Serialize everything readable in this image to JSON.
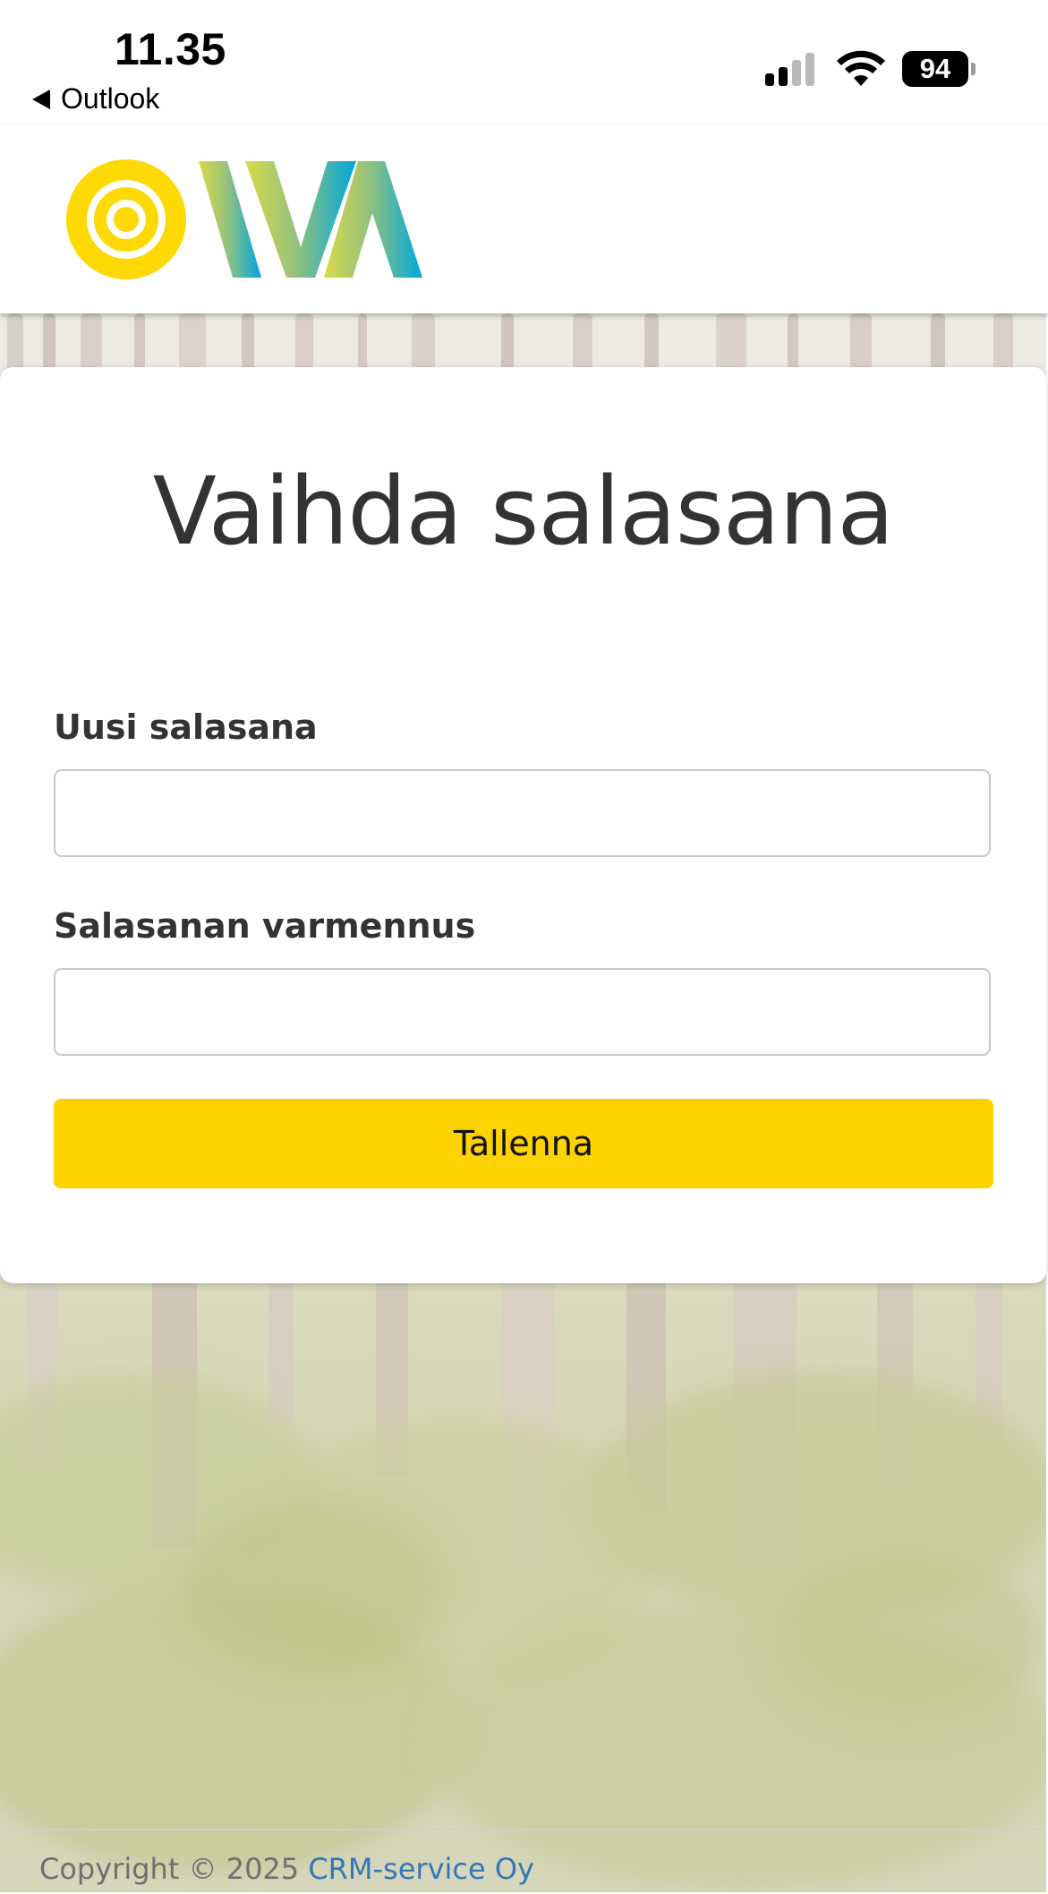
{
  "status_bar": {
    "time": "11.35",
    "back_label": "Outlook",
    "battery": "94"
  },
  "header": {
    "logo_alt": "OIVA"
  },
  "form": {
    "title": "Vaihda salasana",
    "new_password_label": "Uusi salasana",
    "new_password_value": "",
    "confirm_password_label": "Salasanan varmennus",
    "confirm_password_value": "",
    "save_label": "Tallenna"
  },
  "footer": {
    "copyright": "Copyright © 2025",
    "company_link": "CRM-service Oy"
  },
  "colors": {
    "accent_yellow": "#fcd201",
    "link_blue": "#3477b8",
    "logo_yellow": "#ffd400",
    "logo_green": "#8cc084",
    "logo_blue": "#00a6de"
  },
  "icons": [
    "back-arrow-icon",
    "cellular-signal-icon",
    "wifi-icon",
    "battery-icon"
  ]
}
